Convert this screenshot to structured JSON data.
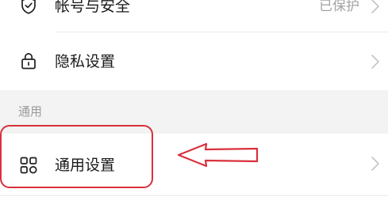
{
  "settings": {
    "account": {
      "label": "帐号与安全",
      "status": "已保护",
      "icon": "shield-check-icon"
    },
    "privacy": {
      "label": "隐私设置",
      "icon": "lock-icon"
    },
    "general_section": {
      "title": "通用"
    },
    "general": {
      "label": "通用设置",
      "icon": "grid-icon"
    }
  },
  "colors": {
    "annotation": "#d9303b",
    "section_background": "#f3f3f3",
    "divider": "#e9e9e9"
  }
}
